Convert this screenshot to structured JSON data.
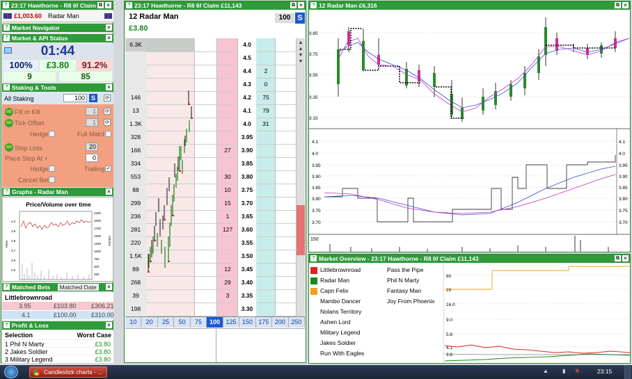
{
  "left": {
    "title": "23:17  Hawthorne - R8 6f Claim",
    "balance": "£1,003.60",
    "runner": "Radar Man",
    "market_navigator": "Market Navigator",
    "market_api_status": "Market & API Status",
    "clock": "01:44",
    "stats": [
      "100%",
      "£3.80",
      "91.2%"
    ],
    "counts": [
      "9",
      "85"
    ],
    "staking_tools": "Staking & Tools",
    "all_staking": "All Staking",
    "all_staking_value": "100",
    "s_label": "S",
    "go": "GO",
    "fill_or_kill": "Fill or Kill",
    "fill_or_kill_value": "1",
    "tick_offset": "Tick Offset",
    "tick_offset_value": "1",
    "hedge": "Hedge",
    "full_match": "Full Match",
    "stop_loss": "Stop Loss",
    "stop_loss_value": "20",
    "place_stop_at": "Place Stop At +",
    "place_stop_value": "0",
    "hedge2": "Hedge",
    "trailing": "Trailing",
    "cancel_bets": "Cancel Bets",
    "graphs_title": "Graphs - Radar Man",
    "graph_title": "Price/Volume over time",
    "graph_yticks": [
      "4.0",
      "3.9",
      "3.8",
      "3.7",
      "3.6",
      "3.5"
    ],
    "graph_ylabel": "Price",
    "graph_vticks": [
      "2250",
      "2000",
      "1750",
      "1500",
      "1250",
      "1000",
      "750",
      "500",
      "250"
    ],
    "graph_vlabel": "Volume",
    "matched_title": "Matched Bets",
    "matched_sort": "Matched Date",
    "matched_runner": "Littlebrownroad",
    "matched_rows": [
      {
        "odds": "3.95",
        "stake": "£103.80",
        "ret": "£306.21"
      },
      {
        "odds": "4.1",
        "stake": "£100.00",
        "ret": "£310.00"
      }
    ],
    "pl_title": "Profit & Loss",
    "pl_head": [
      "Selection",
      "Worst Case"
    ],
    "pl_rows": [
      {
        "sel": "1 Phil N Marty",
        "val": "£3.80"
      },
      {
        "sel": "2 Jakes Soldier",
        "val": "£3.80"
      },
      {
        "sel": "3 Military Legend",
        "val": "£3.80"
      }
    ]
  },
  "ladder": {
    "title": "23:17  Hawthorne - R8 6f Claim   £11,143",
    "runner": "12 Radar Man",
    "price": "£3.80",
    "stake": "100",
    "s_label": "S",
    "top_vol": "6.3K",
    "top_price": "4.0",
    "rows": [
      {
        "vol": "",
        "back": "",
        "price": "4.5",
        "lay": ""
      },
      {
        "vol": "",
        "back": "",
        "price": "4.4",
        "lay": "2"
      },
      {
        "vol": "",
        "back": "",
        "price": "4.3",
        "lay": "0"
      },
      {
        "vol": "146",
        "back": "",
        "price": "4.2",
        "lay": "75"
      },
      {
        "vol": "13",
        "back": "",
        "price": "4.1",
        "lay": "79"
      },
      {
        "vol": "1.3K",
        "back": "",
        "price": "4.0",
        "lay": "31"
      },
      {
        "vol": "328",
        "back": "",
        "price": "3.95",
        "lay": ""
      },
      {
        "vol": "166",
        "back": "27",
        "price": "3.90",
        "lay": ""
      },
      {
        "vol": "334",
        "back": "",
        "price": "3.85",
        "lay": ""
      },
      {
        "vol": "553",
        "back": "30",
        "price": "3.80",
        "lay": ""
      },
      {
        "vol": "88",
        "back": "10",
        "price": "3.75",
        "lay": ""
      },
      {
        "vol": "299",
        "back": "15",
        "price": "3.70",
        "lay": ""
      },
      {
        "vol": "236",
        "back": "1",
        "price": "3.65",
        "lay": ""
      },
      {
        "vol": "281",
        "back": "127",
        "price": "3.60",
        "lay": ""
      },
      {
        "vol": "220",
        "back": "",
        "price": "3.55",
        "lay": ""
      },
      {
        "vol": "1.5K",
        "back": "",
        "price": "3.50",
        "lay": ""
      },
      {
        "vol": "89",
        "back": "12",
        "price": "3.45",
        "lay": ""
      },
      {
        "vol": "268",
        "back": "29",
        "price": "3.40",
        "lay": ""
      },
      {
        "vol": "39",
        "back": "3",
        "price": "3.35",
        "lay": ""
      },
      {
        "vol": "198",
        "back": "",
        "price": "3.30",
        "lay": ""
      },
      {
        "vol": "23",
        "back": "9",
        "price": "3.25",
        "lay": ""
      }
    ],
    "stakes": [
      "10",
      "20",
      "25",
      "50",
      "75",
      "100",
      "125",
      "150",
      "175",
      "200",
      "250"
    ],
    "active_stake": "100"
  },
  "chart": {
    "title": "12 Radar Man  £6,316",
    "top_yticks": [
      "3.85",
      "3.75",
      "3.55",
      "3.35",
      "3.15"
    ],
    "mid_yticks": [
      "4.1",
      "4.0",
      "3.95",
      "3.90",
      "3.85",
      "3.80",
      "3.75",
      "3.70"
    ],
    "vol_label": "150"
  },
  "overview": {
    "title": "Market Overview - 23:17  Hawthorne - R8 6f Claim  £11,143",
    "col1": [
      {
        "name": "Littlebrownroad",
        "color": "#e02020"
      },
      {
        "name": "Radar Man",
        "color": "#1a8a1a"
      },
      {
        "name": "Capn Felix",
        "color": "#f0a020"
      },
      {
        "name": "Mambo Dancer"
      },
      {
        "name": "Nolans Territory"
      },
      {
        "name": "Ashen Lord"
      },
      {
        "name": "Military Legend"
      },
      {
        "name": "Jakes Soldier"
      },
      {
        "name": "Run With Eagles"
      }
    ],
    "col2": [
      "Pass the Pipe",
      "Phil N Marty",
      "Fantasy Man",
      "Joy From Phoenix"
    ],
    "yticks": [
      "80",
      "29",
      "16.0",
      "9.0",
      "5.8",
      "4.1",
      "3.8"
    ]
  },
  "taskbar": {
    "item": "Candlestick charts - ...",
    "time": "23:15"
  }
}
